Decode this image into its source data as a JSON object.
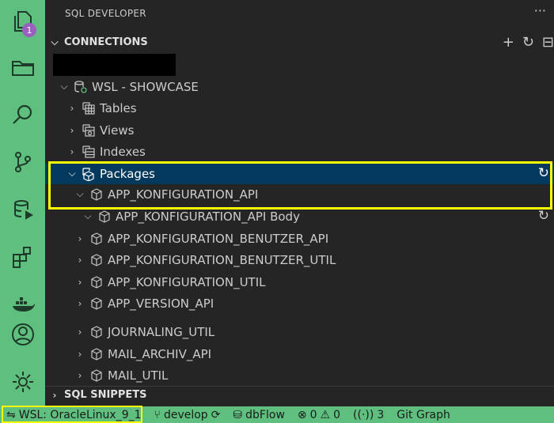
{
  "activity_bar": {
    "explorer_badge": "1",
    "icons": [
      "explorer-icon",
      "search-icon",
      "source-control-icon",
      "sql-developer-icon",
      "extensions-icon",
      "docker-icon",
      "accounts-icon",
      "settings-icon"
    ]
  },
  "sidebar": {
    "header": "SQL DEVELOPER",
    "more": "···",
    "connections_title": "CONNECTIONS",
    "snippets_title": "SQL SNIPPETS",
    "actions": {
      "add": "+",
      "refresh": "↻"
    }
  },
  "tree": {
    "connection": "WSL - SHOWCASE",
    "tables": "Tables",
    "views": "Views",
    "indexes": "Indexes",
    "packages": "Packages",
    "pkg1": "APP_KONFIGURATION_API",
    "pkg1_body": "APP_KONFIGURATION_API Body",
    "pkg2": "APP_KONFIGURATION_BENUTZER_API",
    "pkg3": "APP_KONFIGURATION_BENUTZER_UTIL",
    "pkg4": "APP_KONFIGURATION_UTIL",
    "pkg5": "APP_VERSION_API",
    "pkg6": "JOURNALING_UTIL",
    "pkg7": "MAIL_ARCHIV_API",
    "pkg8": "MAIL_UTIL",
    "refresh_glyph": "↻"
  },
  "statusbar": {
    "remote": "WSL: OracleLinux_9_1",
    "branch": "develop",
    "dbflow": "dbFlow",
    "errors": "0",
    "warnings": "0",
    "ports": "3",
    "git_graph": "Git Graph"
  },
  "colors": {
    "accent": "#5fbf7f",
    "highlight": "#ffff00",
    "selection": "#04395e",
    "badge": "#9b5fc0"
  }
}
